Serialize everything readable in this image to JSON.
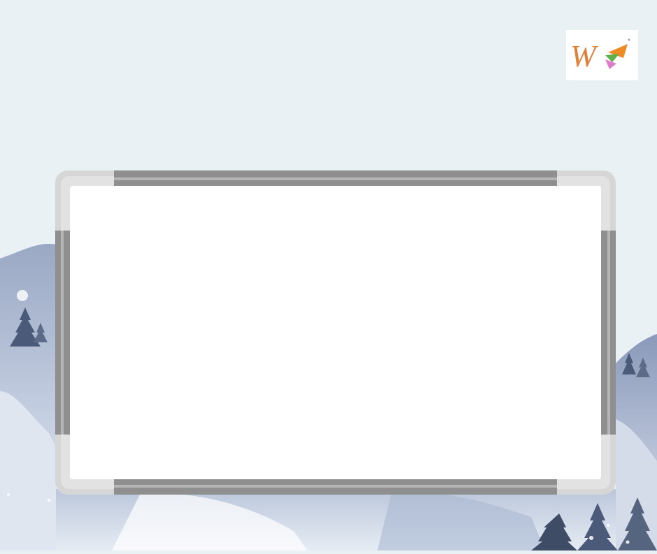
{
  "logo": {
    "letter": "W",
    "icon": "w-logo-icon",
    "colors": {
      "letter": "#e0813a",
      "flag_orange": "#f08a24",
      "flag_green": "#5db04a",
      "flag_pink": "#e07acb"
    }
  },
  "whiteboard": {
    "icon": "whiteboard-frame",
    "colors": {
      "frame_dark": "#8f8f8f",
      "frame_light": "#d6d6d6",
      "surface": "#ffffff"
    }
  },
  "background": {
    "icon": "snowy-mountains-illustration",
    "colors": {
      "sky": "#e9f1f5",
      "mountain_dark": "#7e8fb0",
      "mountain_light": "#c9d4e6",
      "trees": "#4b5a78"
    }
  }
}
